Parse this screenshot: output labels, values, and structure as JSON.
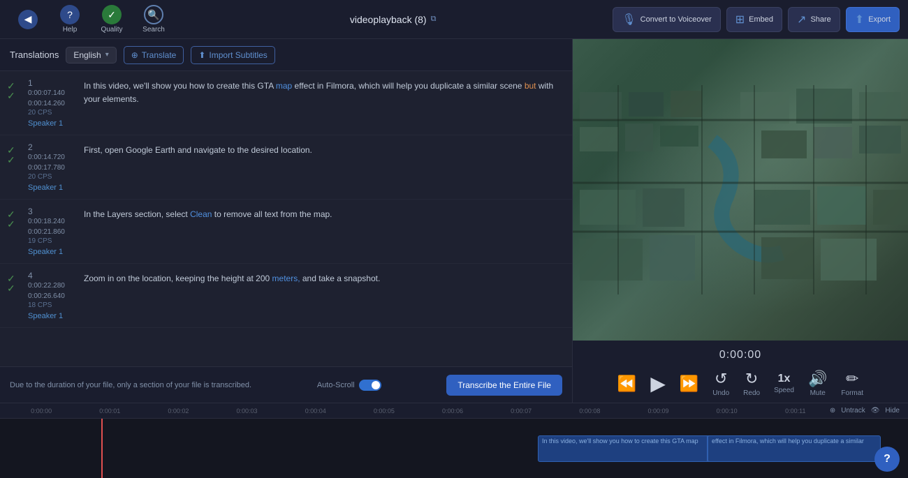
{
  "toolbar": {
    "back_icon": "◀",
    "help_label": "Help",
    "quality_label": "Quality",
    "search_label": "Search",
    "title": "videoplayback (8)",
    "ext_link_icon": "⧉",
    "convert_label": "Convert to Voiceover",
    "embed_label": "Embed",
    "share_label": "Share",
    "export_label": "Export"
  },
  "panel": {
    "translations_label": "Translations",
    "language": "English",
    "chevron": "▾",
    "translate_btn": "Translate",
    "import_btn": "Import Subtitles"
  },
  "subtitles": [
    {
      "num": "1",
      "cps": "20 CPS",
      "time_start": "0:00:07.140",
      "time_end": "0:00:14.260",
      "speaker": "Speaker 1",
      "text": "In this video, we'll show you how to create this GTA map effect in Filmora, which will help you duplicate a similar scene but with your elements.",
      "highlights": [
        {
          "word": "map",
          "color": "blue"
        },
        {
          "word": "but",
          "color": "orange"
        }
      ]
    },
    {
      "num": "2",
      "cps": "20 CPS",
      "time_start": "0:00:14.720",
      "time_end": "0:00:17.780",
      "speaker": "Speaker 1",
      "text": "First, open Google Earth and navigate to the desired location.",
      "highlights": []
    },
    {
      "num": "3",
      "cps": "19 CPS",
      "time_start": "0:00:18.240",
      "time_end": "0:00:21.860",
      "speaker": "Speaker 1",
      "text": "In the Layers section, select Clean to remove all text from the map.",
      "highlights": [
        {
          "word": "Clean",
          "color": "blue"
        }
      ]
    },
    {
      "num": "4",
      "cps": "18 CPS",
      "time_start": "0:00:22.280",
      "time_end": "0:00:26.640",
      "speaker": "Speaker 1",
      "text": "Zoom in on the location, keeping the height at 200 meters, and take a snapshot.",
      "highlights": [
        {
          "word": "meters,",
          "color": "blue"
        }
      ]
    }
  ],
  "transcribe_bar": {
    "message": "Due to the duration of your file, only a section of your file is transcribed.",
    "auto_scroll_label": "Auto-Scroll",
    "transcribe_btn": "Transcribe the Entire File"
  },
  "video": {
    "time": "0:00:00",
    "controls": {
      "rewind_label": "",
      "play_label": "",
      "fast_forward_label": "",
      "undo_label": "Undo",
      "redo_label": "Redo",
      "speed_label": "Speed",
      "speed_value": "1x",
      "mute_label": "Mute",
      "format_label": "Format"
    }
  },
  "timeline": {
    "marks": [
      "0:00:00",
      "0:00:01",
      "0:00:02",
      "0:00:03",
      "0:00:04",
      "0:00:05",
      "0:00:06",
      "0:00:07",
      "0:00:08",
      "0:00:09",
      "0:00:10",
      "0:00:11"
    ],
    "untrack_label": "Untrack",
    "hide_label": "Hide",
    "clip1_text": "In this video, we'll show you how to create this GTA map",
    "clip2_text": "effect in Filmora, which will help you duplicate a similar"
  },
  "help_icon": "?"
}
